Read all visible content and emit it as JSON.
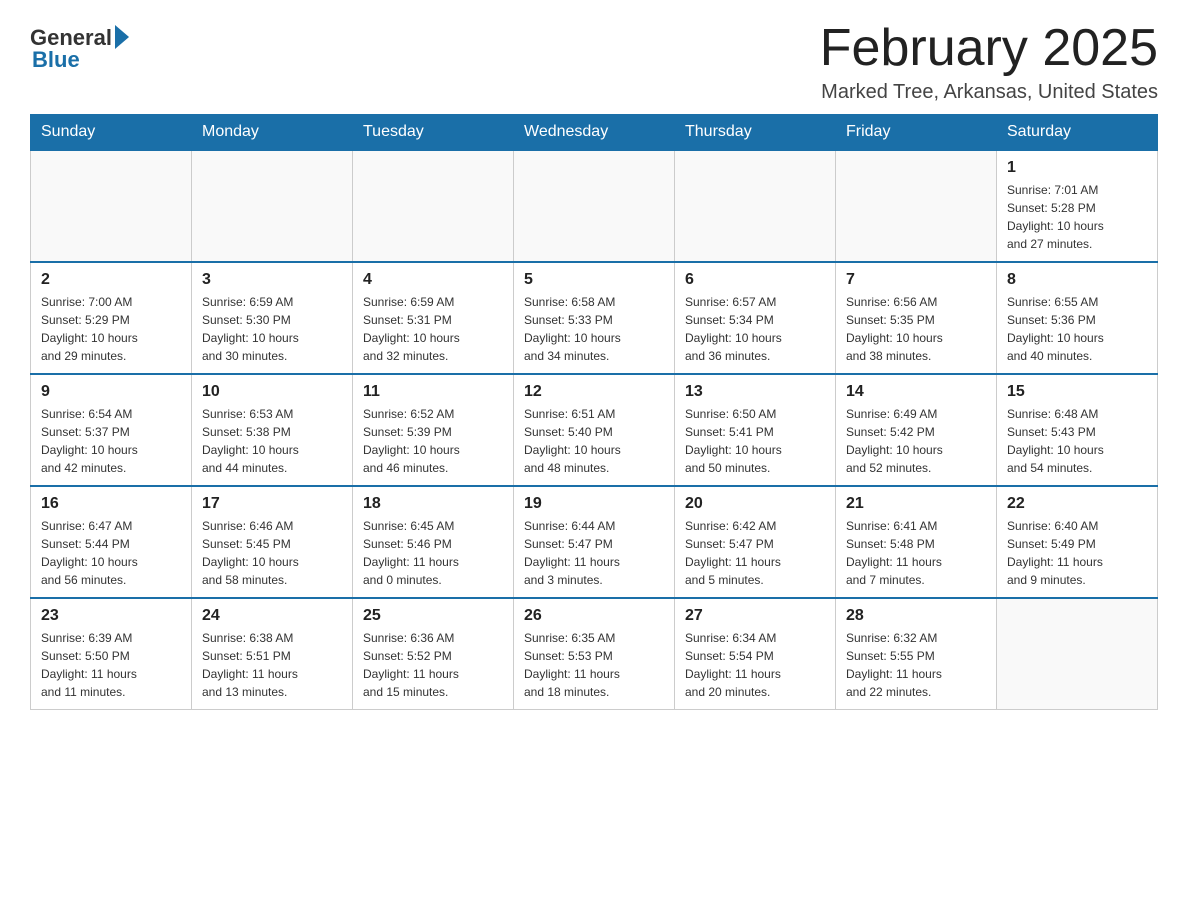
{
  "logo": {
    "general": "General",
    "blue": "Blue"
  },
  "title": "February 2025",
  "location": "Marked Tree, Arkansas, United States",
  "days_of_week": [
    "Sunday",
    "Monday",
    "Tuesday",
    "Wednesday",
    "Thursday",
    "Friday",
    "Saturday"
  ],
  "weeks": [
    [
      {
        "day": "",
        "info": ""
      },
      {
        "day": "",
        "info": ""
      },
      {
        "day": "",
        "info": ""
      },
      {
        "day": "",
        "info": ""
      },
      {
        "day": "",
        "info": ""
      },
      {
        "day": "",
        "info": ""
      },
      {
        "day": "1",
        "info": "Sunrise: 7:01 AM\nSunset: 5:28 PM\nDaylight: 10 hours\nand 27 minutes."
      }
    ],
    [
      {
        "day": "2",
        "info": "Sunrise: 7:00 AM\nSunset: 5:29 PM\nDaylight: 10 hours\nand 29 minutes."
      },
      {
        "day": "3",
        "info": "Sunrise: 6:59 AM\nSunset: 5:30 PM\nDaylight: 10 hours\nand 30 minutes."
      },
      {
        "day": "4",
        "info": "Sunrise: 6:59 AM\nSunset: 5:31 PM\nDaylight: 10 hours\nand 32 minutes."
      },
      {
        "day": "5",
        "info": "Sunrise: 6:58 AM\nSunset: 5:33 PM\nDaylight: 10 hours\nand 34 minutes."
      },
      {
        "day": "6",
        "info": "Sunrise: 6:57 AM\nSunset: 5:34 PM\nDaylight: 10 hours\nand 36 minutes."
      },
      {
        "day": "7",
        "info": "Sunrise: 6:56 AM\nSunset: 5:35 PM\nDaylight: 10 hours\nand 38 minutes."
      },
      {
        "day": "8",
        "info": "Sunrise: 6:55 AM\nSunset: 5:36 PM\nDaylight: 10 hours\nand 40 minutes."
      }
    ],
    [
      {
        "day": "9",
        "info": "Sunrise: 6:54 AM\nSunset: 5:37 PM\nDaylight: 10 hours\nand 42 minutes."
      },
      {
        "day": "10",
        "info": "Sunrise: 6:53 AM\nSunset: 5:38 PM\nDaylight: 10 hours\nand 44 minutes."
      },
      {
        "day": "11",
        "info": "Sunrise: 6:52 AM\nSunset: 5:39 PM\nDaylight: 10 hours\nand 46 minutes."
      },
      {
        "day": "12",
        "info": "Sunrise: 6:51 AM\nSunset: 5:40 PM\nDaylight: 10 hours\nand 48 minutes."
      },
      {
        "day": "13",
        "info": "Sunrise: 6:50 AM\nSunset: 5:41 PM\nDaylight: 10 hours\nand 50 minutes."
      },
      {
        "day": "14",
        "info": "Sunrise: 6:49 AM\nSunset: 5:42 PM\nDaylight: 10 hours\nand 52 minutes."
      },
      {
        "day": "15",
        "info": "Sunrise: 6:48 AM\nSunset: 5:43 PM\nDaylight: 10 hours\nand 54 minutes."
      }
    ],
    [
      {
        "day": "16",
        "info": "Sunrise: 6:47 AM\nSunset: 5:44 PM\nDaylight: 10 hours\nand 56 minutes."
      },
      {
        "day": "17",
        "info": "Sunrise: 6:46 AM\nSunset: 5:45 PM\nDaylight: 10 hours\nand 58 minutes."
      },
      {
        "day": "18",
        "info": "Sunrise: 6:45 AM\nSunset: 5:46 PM\nDaylight: 11 hours\nand 0 minutes."
      },
      {
        "day": "19",
        "info": "Sunrise: 6:44 AM\nSunset: 5:47 PM\nDaylight: 11 hours\nand 3 minutes."
      },
      {
        "day": "20",
        "info": "Sunrise: 6:42 AM\nSunset: 5:47 PM\nDaylight: 11 hours\nand 5 minutes."
      },
      {
        "day": "21",
        "info": "Sunrise: 6:41 AM\nSunset: 5:48 PM\nDaylight: 11 hours\nand 7 minutes."
      },
      {
        "day": "22",
        "info": "Sunrise: 6:40 AM\nSunset: 5:49 PM\nDaylight: 11 hours\nand 9 minutes."
      }
    ],
    [
      {
        "day": "23",
        "info": "Sunrise: 6:39 AM\nSunset: 5:50 PM\nDaylight: 11 hours\nand 11 minutes."
      },
      {
        "day": "24",
        "info": "Sunrise: 6:38 AM\nSunset: 5:51 PM\nDaylight: 11 hours\nand 13 minutes."
      },
      {
        "day": "25",
        "info": "Sunrise: 6:36 AM\nSunset: 5:52 PM\nDaylight: 11 hours\nand 15 minutes."
      },
      {
        "day": "26",
        "info": "Sunrise: 6:35 AM\nSunset: 5:53 PM\nDaylight: 11 hours\nand 18 minutes."
      },
      {
        "day": "27",
        "info": "Sunrise: 6:34 AM\nSunset: 5:54 PM\nDaylight: 11 hours\nand 20 minutes."
      },
      {
        "day": "28",
        "info": "Sunrise: 6:32 AM\nSunset: 5:55 PM\nDaylight: 11 hours\nand 22 minutes."
      },
      {
        "day": "",
        "info": ""
      }
    ]
  ]
}
